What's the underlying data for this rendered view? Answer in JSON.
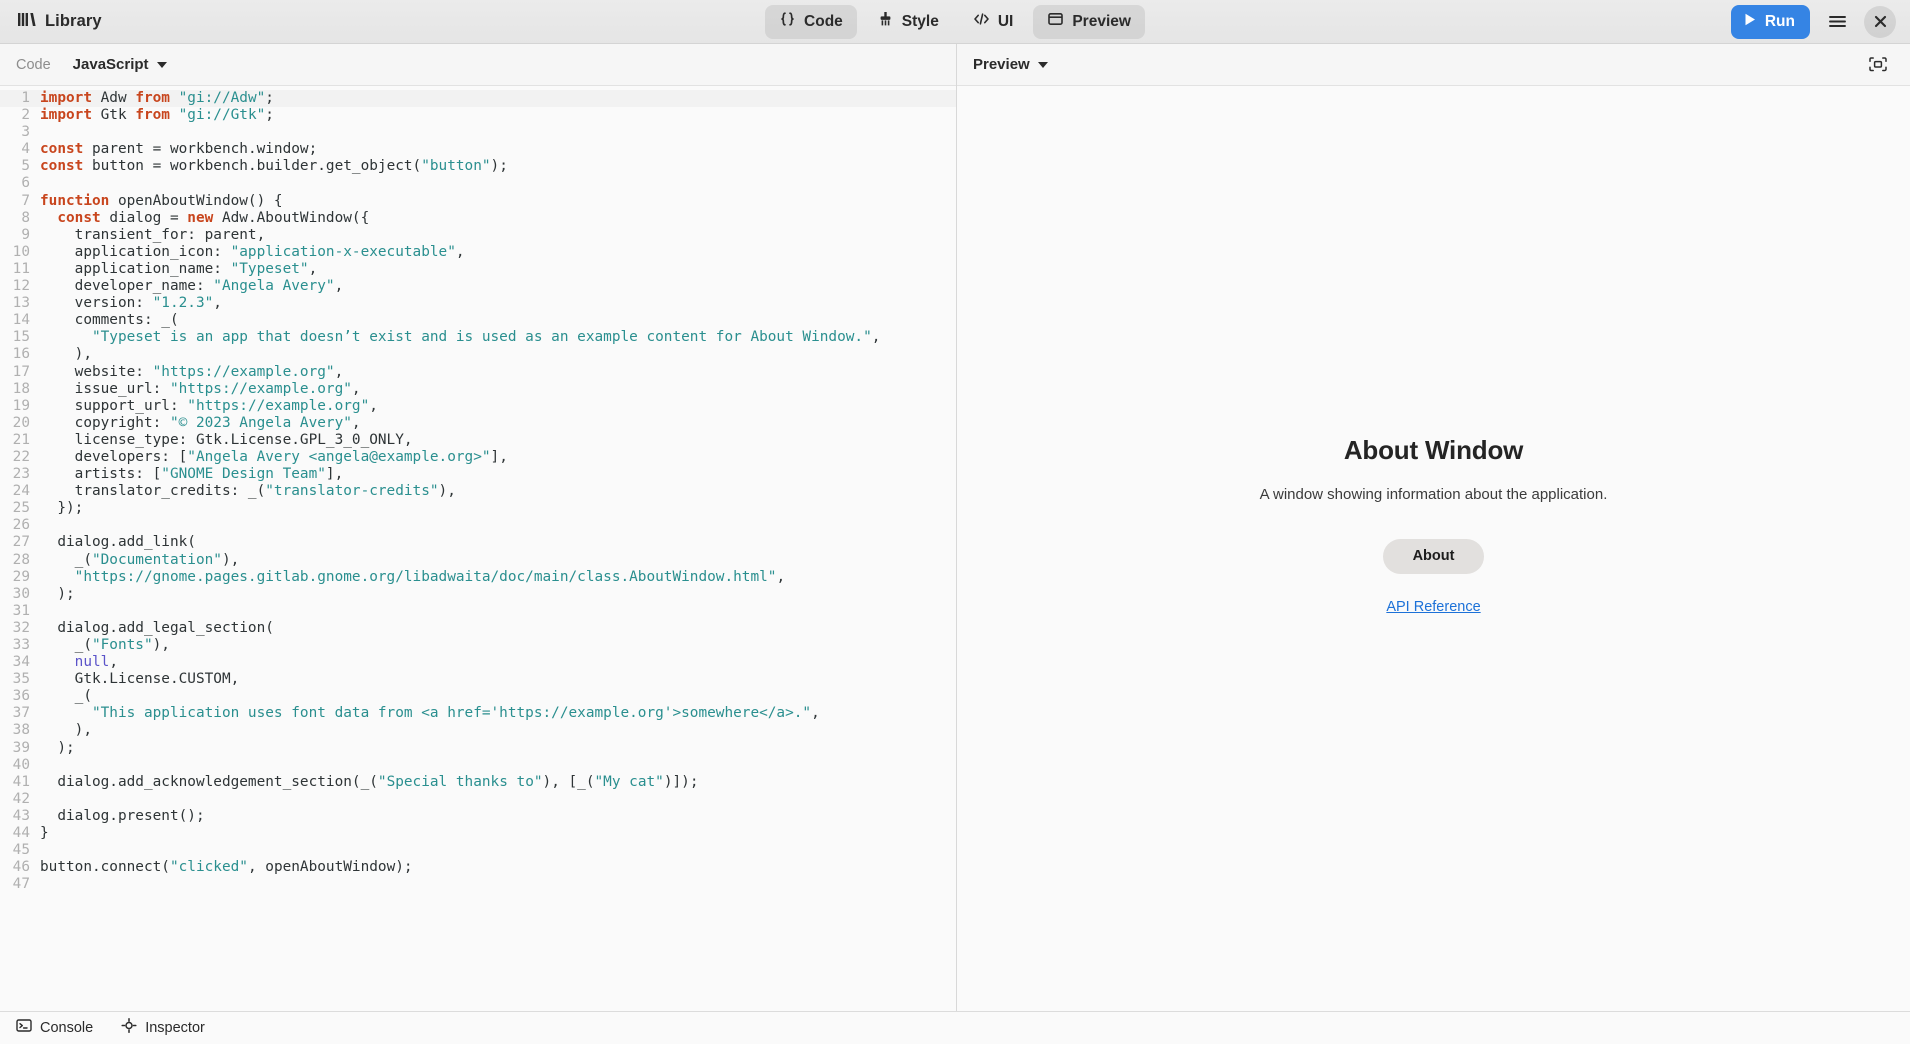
{
  "header": {
    "app_icon": "library-icon",
    "app_title": "Library",
    "modes": [
      {
        "id": "code",
        "label": "Code",
        "icon": "braces-icon",
        "active": true
      },
      {
        "id": "style",
        "label": "Style",
        "icon": "brush-icon",
        "active": false
      },
      {
        "id": "ui",
        "label": "UI",
        "icon": "code-tags-icon",
        "active": false
      },
      {
        "id": "preview",
        "label": "Preview",
        "icon": "window-icon",
        "active": true
      }
    ],
    "run_label": "Run",
    "run_icon": "play-icon",
    "run_color": "#3584e4",
    "menu_icon": "hamburger-menu-icon",
    "close_icon": "close-icon"
  },
  "code_pane": {
    "toolbar": {
      "label": "Code",
      "language": "JavaScript",
      "dropdown_icon": "chevron-down-icon"
    },
    "lines": [
      {
        "n": 1,
        "tokens": [
          {
            "t": "kw",
            "v": "import"
          },
          {
            "t": "p",
            "v": " Adw "
          },
          {
            "t": "kw",
            "v": "from"
          },
          {
            "t": "p",
            "v": " "
          },
          {
            "t": "str",
            "v": "\"gi://Adw\""
          },
          {
            "t": "p",
            "v": ";"
          }
        ]
      },
      {
        "n": 2,
        "tokens": [
          {
            "t": "kw",
            "v": "import"
          },
          {
            "t": "p",
            "v": " Gtk "
          },
          {
            "t": "kw",
            "v": "from"
          },
          {
            "t": "p",
            "v": " "
          },
          {
            "t": "str",
            "v": "\"gi://Gtk\""
          },
          {
            "t": "p",
            "v": ";"
          }
        ]
      },
      {
        "n": 3,
        "tokens": []
      },
      {
        "n": 4,
        "tokens": [
          {
            "t": "kw",
            "v": "const"
          },
          {
            "t": "p",
            "v": " parent = workbench.window;"
          }
        ]
      },
      {
        "n": 5,
        "tokens": [
          {
            "t": "kw",
            "v": "const"
          },
          {
            "t": "p",
            "v": " button = workbench.builder.get_object("
          },
          {
            "t": "str",
            "v": "\"button\""
          },
          {
            "t": "p",
            "v": ");"
          }
        ]
      },
      {
        "n": 6,
        "tokens": []
      },
      {
        "n": 7,
        "tokens": [
          {
            "t": "kw",
            "v": "function"
          },
          {
            "t": "p",
            "v": " openAboutWindow() {"
          }
        ]
      },
      {
        "n": 8,
        "tokens": [
          {
            "t": "p",
            "v": "  "
          },
          {
            "t": "kw",
            "v": "const"
          },
          {
            "t": "p",
            "v": " dialog = "
          },
          {
            "t": "kw",
            "v": "new"
          },
          {
            "t": "p",
            "v": " Adw.AboutWindow({"
          }
        ]
      },
      {
        "n": 9,
        "tokens": [
          {
            "t": "p",
            "v": "    transient_for: parent,"
          }
        ]
      },
      {
        "n": 10,
        "tokens": [
          {
            "t": "p",
            "v": "    application_icon: "
          },
          {
            "t": "str",
            "v": "\"application-x-executable\""
          },
          {
            "t": "p",
            "v": ","
          }
        ]
      },
      {
        "n": 11,
        "tokens": [
          {
            "t": "p",
            "v": "    application_name: "
          },
          {
            "t": "str",
            "v": "\"Typeset\""
          },
          {
            "t": "p",
            "v": ","
          }
        ]
      },
      {
        "n": 12,
        "tokens": [
          {
            "t": "p",
            "v": "    developer_name: "
          },
          {
            "t": "str",
            "v": "\"Angela Avery\""
          },
          {
            "t": "p",
            "v": ","
          }
        ]
      },
      {
        "n": 13,
        "tokens": [
          {
            "t": "p",
            "v": "    version: "
          },
          {
            "t": "str",
            "v": "\"1.2.3\""
          },
          {
            "t": "p",
            "v": ","
          }
        ]
      },
      {
        "n": 14,
        "tokens": [
          {
            "t": "p",
            "v": "    comments: _("
          }
        ]
      },
      {
        "n": 15,
        "tokens": [
          {
            "t": "p",
            "v": "      "
          },
          {
            "t": "str",
            "v": "\"Typeset is an app that doesn’t exist and is used as an example content for About Window.\""
          },
          {
            "t": "p",
            "v": ","
          }
        ]
      },
      {
        "n": 16,
        "tokens": [
          {
            "t": "p",
            "v": "    ),"
          }
        ]
      },
      {
        "n": 17,
        "tokens": [
          {
            "t": "p",
            "v": "    website: "
          },
          {
            "t": "str",
            "v": "\"https://example.org\""
          },
          {
            "t": "p",
            "v": ","
          }
        ]
      },
      {
        "n": 18,
        "tokens": [
          {
            "t": "p",
            "v": "    issue_url: "
          },
          {
            "t": "str",
            "v": "\"https://example.org\""
          },
          {
            "t": "p",
            "v": ","
          }
        ]
      },
      {
        "n": 19,
        "tokens": [
          {
            "t": "p",
            "v": "    support_url: "
          },
          {
            "t": "str",
            "v": "\"https://example.org\""
          },
          {
            "t": "p",
            "v": ","
          }
        ]
      },
      {
        "n": 20,
        "tokens": [
          {
            "t": "p",
            "v": "    copyright: "
          },
          {
            "t": "str",
            "v": "\"© 2023 Angela Avery\""
          },
          {
            "t": "p",
            "v": ","
          }
        ]
      },
      {
        "n": 21,
        "tokens": [
          {
            "t": "p",
            "v": "    license_type: Gtk.License.GPL_3_0_ONLY,"
          }
        ]
      },
      {
        "n": 22,
        "tokens": [
          {
            "t": "p",
            "v": "    developers: ["
          },
          {
            "t": "str",
            "v": "\"Angela Avery <angela@example.org>\""
          },
          {
            "t": "p",
            "v": "],"
          }
        ]
      },
      {
        "n": 23,
        "tokens": [
          {
            "t": "p",
            "v": "    artists: ["
          },
          {
            "t": "str",
            "v": "\"GNOME Design Team\""
          },
          {
            "t": "p",
            "v": "],"
          }
        ]
      },
      {
        "n": 24,
        "tokens": [
          {
            "t": "p",
            "v": "    translator_credits: _("
          },
          {
            "t": "str",
            "v": "\"translator-credits\""
          },
          {
            "t": "p",
            "v": "),"
          }
        ]
      },
      {
        "n": 25,
        "tokens": [
          {
            "t": "p",
            "v": "  });"
          }
        ]
      },
      {
        "n": 26,
        "tokens": []
      },
      {
        "n": 27,
        "tokens": [
          {
            "t": "p",
            "v": "  dialog.add_link("
          }
        ]
      },
      {
        "n": 28,
        "tokens": [
          {
            "t": "p",
            "v": "    _("
          },
          {
            "t": "str",
            "v": "\"Documentation\""
          },
          {
            "t": "p",
            "v": "),"
          }
        ]
      },
      {
        "n": 29,
        "tokens": [
          {
            "t": "p",
            "v": "    "
          },
          {
            "t": "str",
            "v": "\"https://gnome.pages.gitlab.gnome.org/libadwaita/doc/main/class.AboutWindow.html\""
          },
          {
            "t": "p",
            "v": ","
          }
        ]
      },
      {
        "n": 30,
        "tokens": [
          {
            "t": "p",
            "v": "  );"
          }
        ]
      },
      {
        "n": 31,
        "tokens": []
      },
      {
        "n": 32,
        "tokens": [
          {
            "t": "p",
            "v": "  dialog.add_legal_section("
          }
        ]
      },
      {
        "n": 33,
        "tokens": [
          {
            "t": "p",
            "v": "    _("
          },
          {
            "t": "str",
            "v": "\"Fonts\""
          },
          {
            "t": "p",
            "v": "),"
          }
        ]
      },
      {
        "n": 34,
        "tokens": [
          {
            "t": "p",
            "v": "    "
          },
          {
            "t": "nul",
            "v": "null"
          },
          {
            "t": "p",
            "v": ","
          }
        ]
      },
      {
        "n": 35,
        "tokens": [
          {
            "t": "p",
            "v": "    Gtk.License.CUSTOM,"
          }
        ]
      },
      {
        "n": 36,
        "tokens": [
          {
            "t": "p",
            "v": "    _("
          }
        ]
      },
      {
        "n": 37,
        "tokens": [
          {
            "t": "p",
            "v": "      "
          },
          {
            "t": "str",
            "v": "\"This application uses font data from <a href='https://example.org'>somewhere</a>.\""
          },
          {
            "t": "p",
            "v": ","
          }
        ]
      },
      {
        "n": 38,
        "tokens": [
          {
            "t": "p",
            "v": "    ),"
          }
        ]
      },
      {
        "n": 39,
        "tokens": [
          {
            "t": "p",
            "v": "  );"
          }
        ]
      },
      {
        "n": 40,
        "tokens": []
      },
      {
        "n": 41,
        "tokens": [
          {
            "t": "p",
            "v": "  dialog.add_acknowledgement_section(_("
          },
          {
            "t": "str",
            "v": "\"Special thanks to\""
          },
          {
            "t": "p",
            "v": "), [_("
          },
          {
            "t": "str",
            "v": "\"My cat\""
          },
          {
            "t": "p",
            "v": ")]);"
          }
        ]
      },
      {
        "n": 42,
        "tokens": []
      },
      {
        "n": 43,
        "tokens": [
          {
            "t": "p",
            "v": "  dialog.present();"
          }
        ]
      },
      {
        "n": 44,
        "tokens": [
          {
            "t": "p",
            "v": "}"
          }
        ]
      },
      {
        "n": 45,
        "tokens": []
      },
      {
        "n": 46,
        "tokens": [
          {
            "t": "p",
            "v": "button.connect("
          },
          {
            "t": "str",
            "v": "\"clicked\""
          },
          {
            "t": "p",
            "v": ", openAboutWindow);"
          }
        ]
      },
      {
        "n": 47,
        "tokens": []
      }
    ]
  },
  "preview_pane": {
    "toolbar": {
      "label": "Preview",
      "dropdown_icon": "chevron-down-icon",
      "screenshot_icon": "screenshot-icon"
    },
    "title": "About Window",
    "subtitle": "A window showing information about the application.",
    "about_button": "About",
    "api_link": "API Reference",
    "link_color": "#1c71d8"
  },
  "statusbar": {
    "items": [
      {
        "label": "Console",
        "icon": "terminal-icon"
      },
      {
        "label": "Inspector",
        "icon": "crosshair-icon"
      }
    ]
  }
}
